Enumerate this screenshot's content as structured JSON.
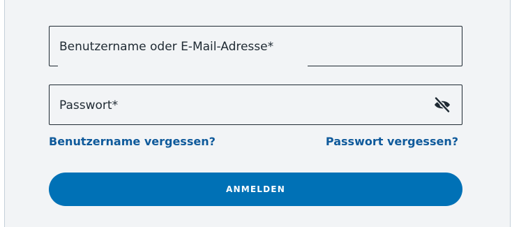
{
  "form": {
    "username_label": "Benutzername oder E-Mail-Adresse*",
    "password_label": "Passwort*",
    "password_toggle_icon": "eye-slash-icon",
    "forgot_username_link": "Benutzername vergessen?",
    "forgot_password_link": "Passwort vergessen?",
    "submit_label": "ANMELDEN"
  },
  "colors": {
    "background": "#f2f4f6",
    "field_border": "#1f2a33",
    "link": "#0f5a9b",
    "button": "#0071b6",
    "button_text": "#ffffff"
  }
}
